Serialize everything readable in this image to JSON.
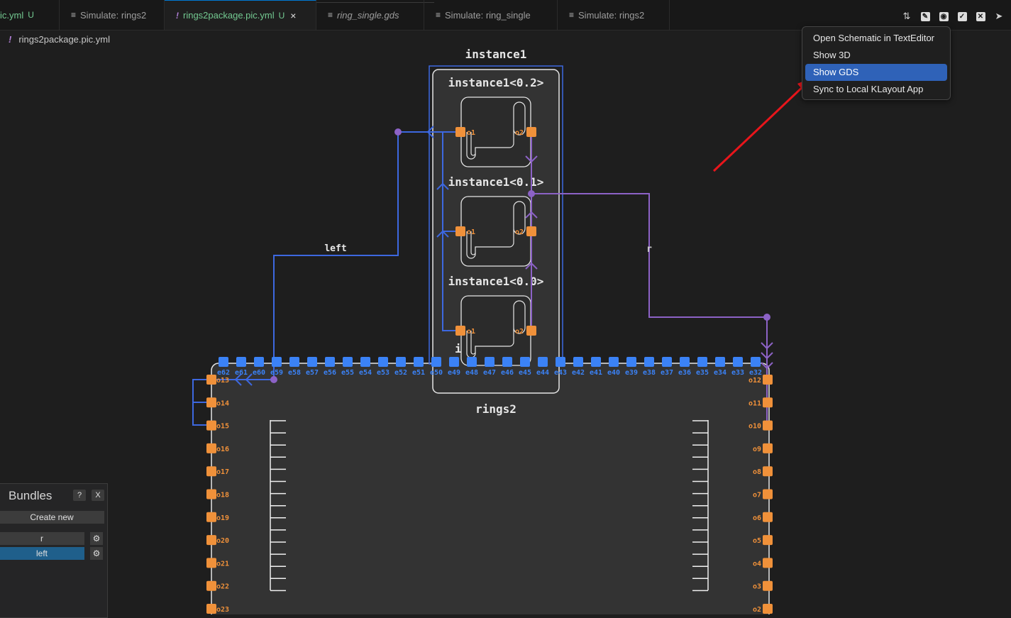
{
  "tabs": [
    {
      "icon": "",
      "label": "ic.yml",
      "badge": "U",
      "active": false,
      "style": "green"
    },
    {
      "icon": "lines-icon",
      "label": "Simulate: rings2",
      "badge": "",
      "active": false,
      "style": ""
    },
    {
      "icon": "bang-icon",
      "label": "rings2package.pic.yml",
      "badge": "U",
      "active": true,
      "style": "green"
    },
    {
      "icon": "lines-icon",
      "label": "ring_single.gds",
      "badge": "",
      "active": false,
      "style": "it"
    },
    {
      "icon": "lines-icon",
      "label": "Simulate: ring_single",
      "badge": "",
      "active": false,
      "style": ""
    },
    {
      "icon": "lines-icon",
      "label": "Simulate: rings2",
      "badge": "",
      "active": false,
      "style": ""
    }
  ],
  "tab_close": "×",
  "breadcrumb": {
    "file": "rings2package.pic.yml"
  },
  "toolbar": [
    "compare-icon",
    "edit-icon",
    "eye-icon",
    "check-icon",
    "shuffle-icon",
    "send-icon"
  ],
  "context_menu": {
    "items": [
      "Open Schematic in TextEditor",
      "Show 3D",
      "Show GDS",
      "Sync to Local KLayout App"
    ],
    "selected": "Show GDS"
  },
  "schematic": {
    "instance_title": "instance1",
    "sub_instances": [
      "instance1<0.2>",
      "instance1<0.1>",
      "instance1<0.0>"
    ],
    "port_labels": {
      "left": "o1",
      "right": "o2"
    },
    "package_title": "rings2",
    "hidden_label": "i",
    "net_labels": {
      "left": "left",
      "right": "r"
    },
    "top_ports": [
      "e62",
      "e61",
      "e60",
      "e59",
      "e58",
      "e57",
      "e56",
      "e55",
      "e54",
      "e53",
      "e52",
      "e51",
      "e50",
      "e49",
      "e48",
      "e47",
      "e46",
      "e45",
      "e44",
      "e43",
      "e42",
      "e41",
      "e40",
      "e39",
      "e38",
      "e37",
      "e36",
      "e35",
      "e34",
      "e33",
      "e32"
    ],
    "left_ports": [
      "o13",
      "o14",
      "o15",
      "o16",
      "o17",
      "o18",
      "o19",
      "o20",
      "o21",
      "o22",
      "o23"
    ],
    "right_ports": [
      "o12",
      "o11",
      "o10",
      "o9",
      "o8",
      "o7",
      "o6",
      "o5",
      "o4",
      "o3",
      "o2"
    ],
    "colors": {
      "bg": "#1e1e1e",
      "box": "#2b2b2b",
      "blue": "#3d68e0",
      "purple": "#8c62c6",
      "orange": "#f0913a",
      "port_blue": "#3b82f6",
      "arrow": "#e8151b"
    }
  },
  "bundles": {
    "title": "Bundles",
    "help": "?",
    "close": "X",
    "create_label": "Create new",
    "items": [
      {
        "label": "r",
        "selected": false
      },
      {
        "label": "left",
        "selected": true
      }
    ]
  }
}
